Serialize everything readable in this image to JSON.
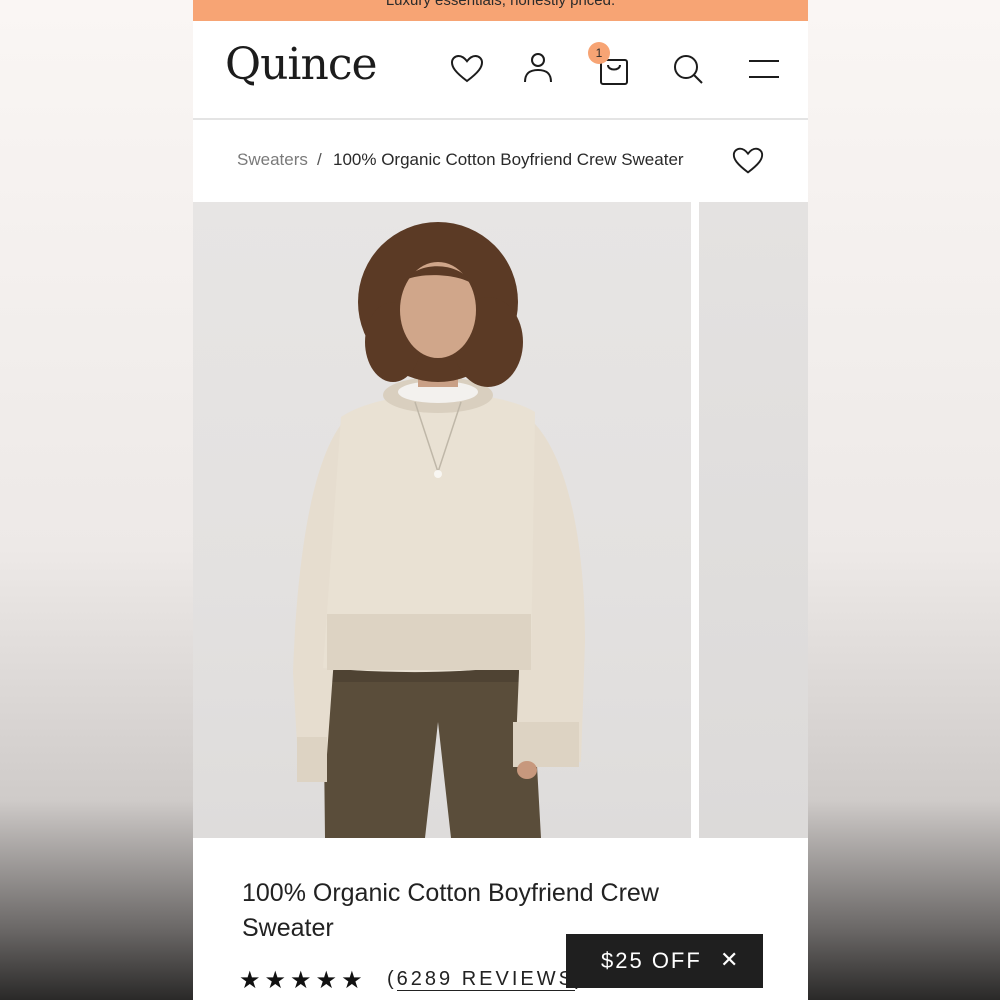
{
  "promo": {
    "text": "Luxury essentials, honestly priced."
  },
  "header": {
    "logo": "Quince",
    "cart_count": "1",
    "icons": [
      "heart-icon",
      "account-icon",
      "cart-icon",
      "search-icon",
      "menu-icon"
    ]
  },
  "breadcrumb": {
    "parent": "Sweaters",
    "separator": "/",
    "current": "100% Organic Cotton Boyfriend Crew Sweater"
  },
  "product": {
    "title": "100% Organic Cotton Boyfriend Crew Sweater",
    "stars": "★★★★★",
    "reviews_open": "(",
    "reviews_text": "6289 REVIEWS",
    "reviews_close": ")"
  },
  "discount": {
    "label": "$25 OFF",
    "close": "✕"
  },
  "colors": {
    "accent": "#f7a474",
    "sweater": "#e8e0d2",
    "pants": "#5a4d3a"
  }
}
